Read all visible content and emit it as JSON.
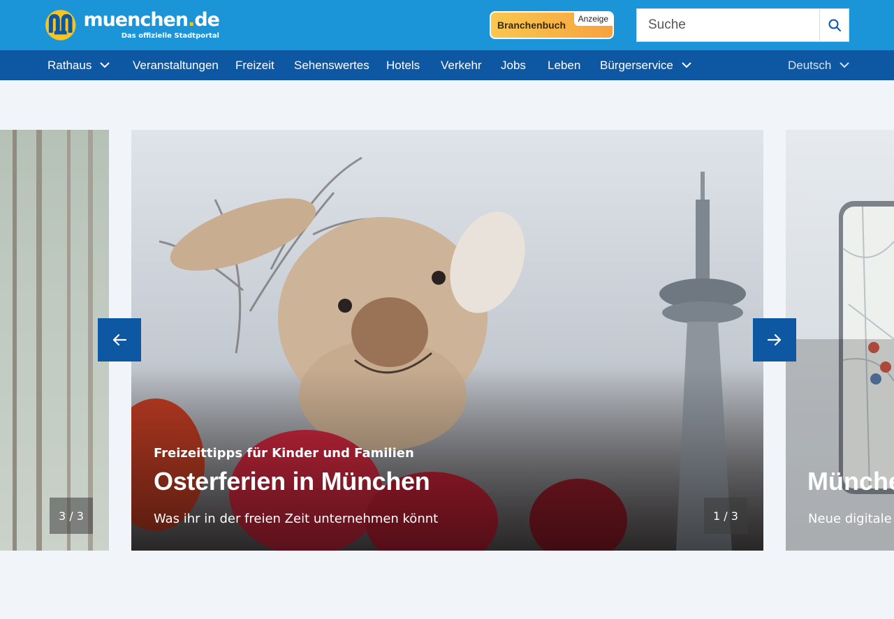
{
  "header": {
    "logo": {
      "main": "muenchen",
      "dot": ".",
      "tld": "de",
      "tagline": "Das offizielle Stadtportal"
    },
    "branchenbuch": {
      "label": "Branchenbuch",
      "ad_badge": "Anzeige"
    },
    "search": {
      "placeholder": "Suche",
      "icon": "search-icon"
    }
  },
  "nav": {
    "items": [
      {
        "label": "Rathaus",
        "dropdown": true
      },
      {
        "label": "Veranstaltungen"
      },
      {
        "label": "Freizeit"
      },
      {
        "label": "Sehenswertes"
      },
      {
        "label": "Hotels"
      },
      {
        "label": "Verkehr"
      },
      {
        "label": "Jobs"
      },
      {
        "label": "Leben"
      },
      {
        "label": "Bürgerservice",
        "dropdown": true
      }
    ],
    "language": "Deutsch"
  },
  "carousel": {
    "prev_slide": {
      "counter": "3 / 3"
    },
    "current_slide": {
      "kicker": "Freizeittipps für Kinder und Familien",
      "title": "Osterferien in München",
      "teaser": "Was ihr in der freien Zeit unternehmen könnt",
      "counter": "1 / 3"
    },
    "next_slide": {
      "title": "Münchener",
      "teaser": "Neue digitale K"
    }
  },
  "colors": {
    "header": "#1b95d7",
    "nav": "#0d57a3",
    "accent": "#f7c51b",
    "page_bg": "#f1f5f9"
  }
}
